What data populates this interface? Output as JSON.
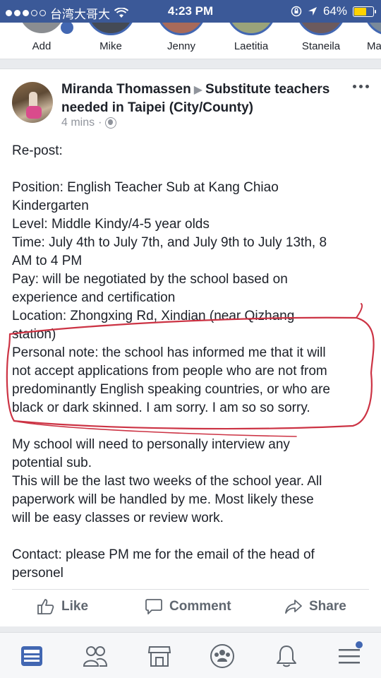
{
  "status_bar": {
    "carrier": "台湾大哥大",
    "time": "4:23 PM",
    "battery": "64%"
  },
  "friends": [
    {
      "name": "Add"
    },
    {
      "name": "Mike"
    },
    {
      "name": "Jenny"
    },
    {
      "name": "Laetitia"
    },
    {
      "name": "Staneila"
    },
    {
      "name": "Ma"
    }
  ],
  "post": {
    "author": "Miranda Thomassen",
    "group": "Substitute teachers needed in Taipei (City/County)",
    "time_ago": "4 mins",
    "lines": [
      "Re-post:",
      "",
      "Position: English Teacher Sub at Kang Chiao",
      "Kindergarten",
      "Level: Middle Kindy/4-5 year olds",
      "Time: July 4th to July 7th, and July 9th to July 13th, 8",
      "AM to 4 PM",
      "Pay: will be negotiated by the school based on",
      "experience and certification",
      "Location: Zhongxing Rd, Xindian (near Qizhang",
      "station)",
      "Personal note: the school has informed me that it will",
      "not accept applications from people who are not from",
      "predominantly English speaking countries, or who are",
      "black or dark skinned. I am sorry. I am so so sorry.",
      "",
      "My school will need to personally interview any",
      "potential sub.",
      "This will be the last two weeks of the school year. All",
      "paperwork will be handled by me. Most likely these",
      "will be easy classes or review work.",
      "",
      "Contact: please PM me for the email of the head of",
      "personel"
    ],
    "actions": {
      "like": "Like",
      "comment": "Comment",
      "share": "Share"
    }
  },
  "colors": {
    "brand": "#3b5998",
    "annotation": "#cc3344"
  }
}
